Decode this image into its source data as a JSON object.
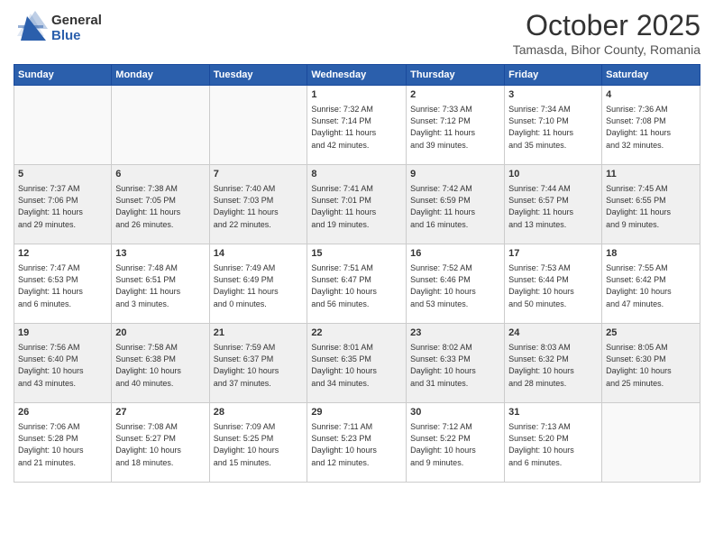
{
  "header": {
    "logo": {
      "general": "General",
      "blue": "Blue"
    },
    "title": "October 2025",
    "location": "Tamasda, Bihor County, Romania"
  },
  "calendar": {
    "weekdays": [
      "Sunday",
      "Monday",
      "Tuesday",
      "Wednesday",
      "Thursday",
      "Friday",
      "Saturday"
    ],
    "weeks": [
      [
        {
          "day": "",
          "info": ""
        },
        {
          "day": "",
          "info": ""
        },
        {
          "day": "",
          "info": ""
        },
        {
          "day": "1",
          "info": "Sunrise: 7:32 AM\nSunset: 7:14 PM\nDaylight: 11 hours\nand 42 minutes."
        },
        {
          "day": "2",
          "info": "Sunrise: 7:33 AM\nSunset: 7:12 PM\nDaylight: 11 hours\nand 39 minutes."
        },
        {
          "day": "3",
          "info": "Sunrise: 7:34 AM\nSunset: 7:10 PM\nDaylight: 11 hours\nand 35 minutes."
        },
        {
          "day": "4",
          "info": "Sunrise: 7:36 AM\nSunset: 7:08 PM\nDaylight: 11 hours\nand 32 minutes."
        }
      ],
      [
        {
          "day": "5",
          "info": "Sunrise: 7:37 AM\nSunset: 7:06 PM\nDaylight: 11 hours\nand 29 minutes."
        },
        {
          "day": "6",
          "info": "Sunrise: 7:38 AM\nSunset: 7:05 PM\nDaylight: 11 hours\nand 26 minutes."
        },
        {
          "day": "7",
          "info": "Sunrise: 7:40 AM\nSunset: 7:03 PM\nDaylight: 11 hours\nand 22 minutes."
        },
        {
          "day": "8",
          "info": "Sunrise: 7:41 AM\nSunset: 7:01 PM\nDaylight: 11 hours\nand 19 minutes."
        },
        {
          "day": "9",
          "info": "Sunrise: 7:42 AM\nSunset: 6:59 PM\nDaylight: 11 hours\nand 16 minutes."
        },
        {
          "day": "10",
          "info": "Sunrise: 7:44 AM\nSunset: 6:57 PM\nDaylight: 11 hours\nand 13 minutes."
        },
        {
          "day": "11",
          "info": "Sunrise: 7:45 AM\nSunset: 6:55 PM\nDaylight: 11 hours\nand 9 minutes."
        }
      ],
      [
        {
          "day": "12",
          "info": "Sunrise: 7:47 AM\nSunset: 6:53 PM\nDaylight: 11 hours\nand 6 minutes."
        },
        {
          "day": "13",
          "info": "Sunrise: 7:48 AM\nSunset: 6:51 PM\nDaylight: 11 hours\nand 3 minutes."
        },
        {
          "day": "14",
          "info": "Sunrise: 7:49 AM\nSunset: 6:49 PM\nDaylight: 11 hours\nand 0 minutes."
        },
        {
          "day": "15",
          "info": "Sunrise: 7:51 AM\nSunset: 6:47 PM\nDaylight: 10 hours\nand 56 minutes."
        },
        {
          "day": "16",
          "info": "Sunrise: 7:52 AM\nSunset: 6:46 PM\nDaylight: 10 hours\nand 53 minutes."
        },
        {
          "day": "17",
          "info": "Sunrise: 7:53 AM\nSunset: 6:44 PM\nDaylight: 10 hours\nand 50 minutes."
        },
        {
          "day": "18",
          "info": "Sunrise: 7:55 AM\nSunset: 6:42 PM\nDaylight: 10 hours\nand 47 minutes."
        }
      ],
      [
        {
          "day": "19",
          "info": "Sunrise: 7:56 AM\nSunset: 6:40 PM\nDaylight: 10 hours\nand 43 minutes."
        },
        {
          "day": "20",
          "info": "Sunrise: 7:58 AM\nSunset: 6:38 PM\nDaylight: 10 hours\nand 40 minutes."
        },
        {
          "day": "21",
          "info": "Sunrise: 7:59 AM\nSunset: 6:37 PM\nDaylight: 10 hours\nand 37 minutes."
        },
        {
          "day": "22",
          "info": "Sunrise: 8:01 AM\nSunset: 6:35 PM\nDaylight: 10 hours\nand 34 minutes."
        },
        {
          "day": "23",
          "info": "Sunrise: 8:02 AM\nSunset: 6:33 PM\nDaylight: 10 hours\nand 31 minutes."
        },
        {
          "day": "24",
          "info": "Sunrise: 8:03 AM\nSunset: 6:32 PM\nDaylight: 10 hours\nand 28 minutes."
        },
        {
          "day": "25",
          "info": "Sunrise: 8:05 AM\nSunset: 6:30 PM\nDaylight: 10 hours\nand 25 minutes."
        }
      ],
      [
        {
          "day": "26",
          "info": "Sunrise: 7:06 AM\nSunset: 5:28 PM\nDaylight: 10 hours\nand 21 minutes."
        },
        {
          "day": "27",
          "info": "Sunrise: 7:08 AM\nSunset: 5:27 PM\nDaylight: 10 hours\nand 18 minutes."
        },
        {
          "day": "28",
          "info": "Sunrise: 7:09 AM\nSunset: 5:25 PM\nDaylight: 10 hours\nand 15 minutes."
        },
        {
          "day": "29",
          "info": "Sunrise: 7:11 AM\nSunset: 5:23 PM\nDaylight: 10 hours\nand 12 minutes."
        },
        {
          "day": "30",
          "info": "Sunrise: 7:12 AM\nSunset: 5:22 PM\nDaylight: 10 hours\nand 9 minutes."
        },
        {
          "day": "31",
          "info": "Sunrise: 7:13 AM\nSunset: 5:20 PM\nDaylight: 10 hours\nand 6 minutes."
        },
        {
          "day": "",
          "info": ""
        }
      ]
    ]
  }
}
